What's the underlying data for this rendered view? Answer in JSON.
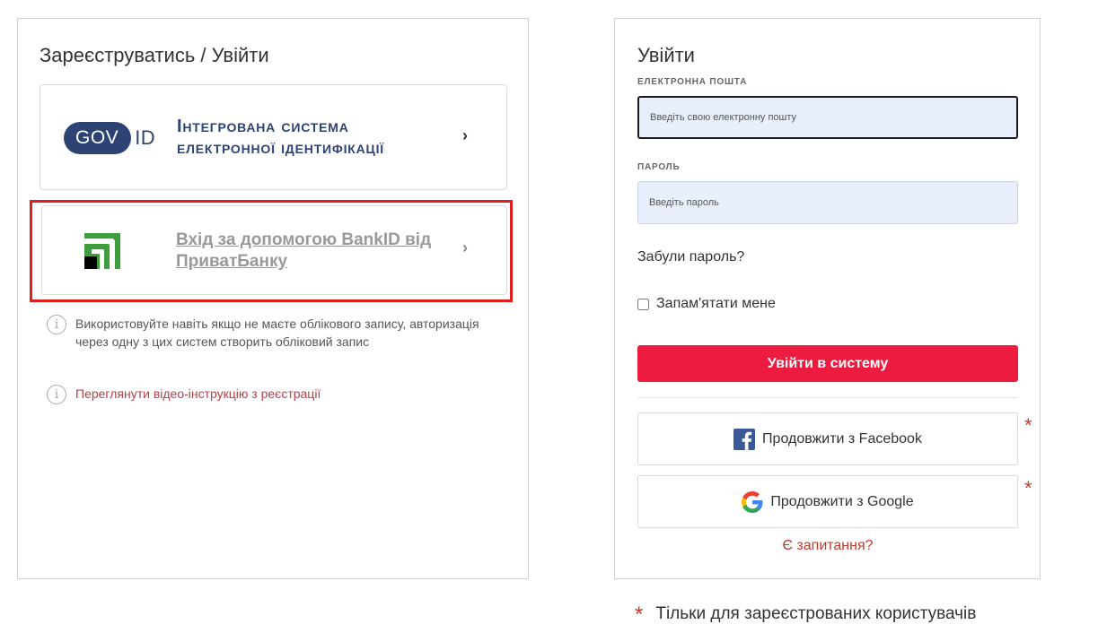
{
  "left_panel": {
    "title": "Зареєструватись / Увійти",
    "govid": {
      "logo_gov": "GOV",
      "logo_id": "ID",
      "text_line1": "Інтегрована система",
      "text_line2": "електронної ідентифікації",
      "brand_color": "#2d4373"
    },
    "bankid": {
      "label": "Вхід за допомогою BankID від ПриватБанку",
      "logo_color": "#3e9e3e"
    },
    "hint_text": "Використовуйте навіть якщо не маєте облікового запису, авторизація через одну з цих систем створить обліковий запис",
    "video_link": "Переглянути відео-інструкцію з реєстрації",
    "highlight_color": "#e01e1e"
  },
  "right_panel": {
    "title": "Увійти",
    "email_label": "ЕЛЕКТРОННА ПОШТА",
    "email_placeholder": "Введіть свою електронну пошту",
    "password_label": "ПАРОЛЬ",
    "password_placeholder": "Введіть пароль",
    "forgot_password": "Забули пароль?",
    "remember_me": "Запам'ятати мене",
    "login_button": "Увійти в систему",
    "facebook_button": "Продовжити з Facebook",
    "google_button": "Продовжити з Google",
    "asterisk": "*",
    "question_link": "Є запитання?",
    "accent_color": "#ed1b40"
  },
  "footnote": {
    "star": "*",
    "text": "Тільки для зареєстрованих користувачів"
  }
}
